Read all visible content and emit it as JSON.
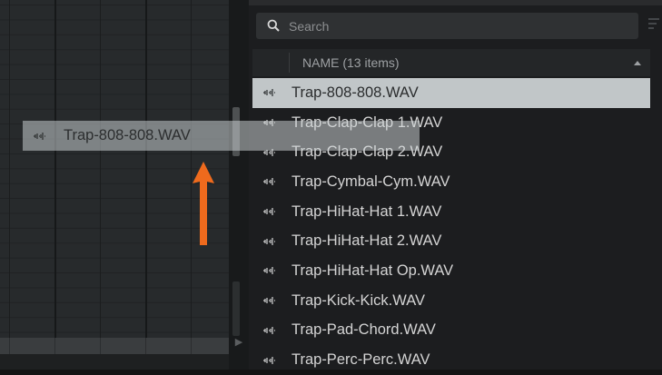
{
  "browser": {
    "search": {
      "placeholder": "Search",
      "value": ""
    },
    "header": {
      "name_column": "NAME (13 items)"
    },
    "files": [
      {
        "name": "Trap-808-808.WAV",
        "selected": true
      },
      {
        "name": "Trap-Clap-Clap 1.WAV",
        "selected": false
      },
      {
        "name": "Trap-Clap-Clap 2.WAV",
        "selected": false
      },
      {
        "name": "Trap-Cymbal-Cym.WAV",
        "selected": false
      },
      {
        "name": "Trap-HiHat-Hat 1.WAV",
        "selected": false
      },
      {
        "name": "Trap-HiHat-Hat 2.WAV",
        "selected": false
      },
      {
        "name": "Trap-HiHat-Hat Op.WAV",
        "selected": false
      },
      {
        "name": "Trap-Kick-Kick.WAV",
        "selected": false
      },
      {
        "name": "Trap-Pad-Chord.WAV",
        "selected": false
      },
      {
        "name": "Trap-Perc-Perc.WAV",
        "selected": false
      }
    ]
  },
  "drag_ghost": {
    "label": "Trap-808-808.WAV"
  },
  "icons": {
    "search": "search-icon",
    "filter": "filter-icon",
    "sort": "sort-ascending-icon",
    "file": "audio-waveform-icon",
    "arrow": "up-arrow-icon"
  },
  "colors": {
    "selection": "#c1c6c8",
    "annotation_arrow": "#ee6a1d",
    "panel_background": "#1c1d1f"
  }
}
